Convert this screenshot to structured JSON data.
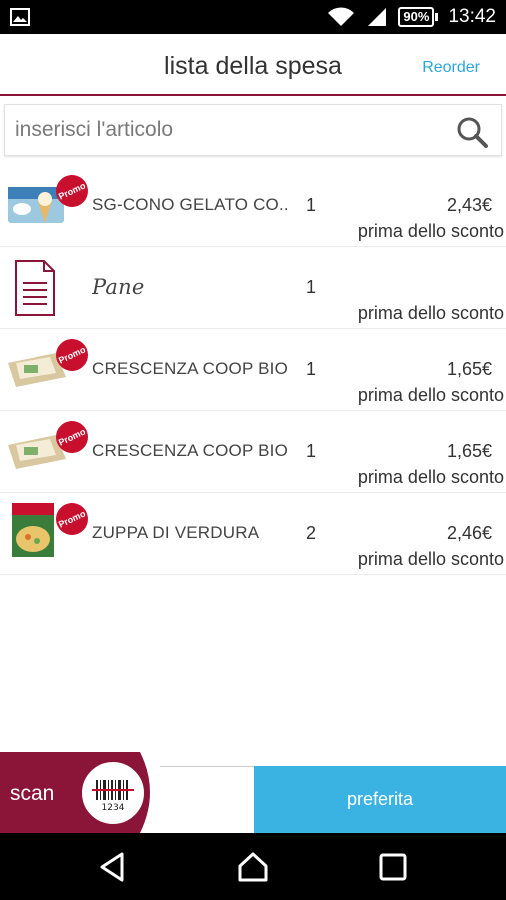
{
  "status_bar": {
    "battery": "90%",
    "time": "13:42",
    "icons": [
      "image-icon",
      "wifi-icon",
      "signal-icon",
      "battery-icon"
    ]
  },
  "header": {
    "title": "lista della spesa",
    "reorder_label": "Reorder"
  },
  "search": {
    "placeholder": "inserisci l'articolo",
    "value": ""
  },
  "items": [
    {
      "name": "SG-CONO GELATO CO..",
      "qty": "1",
      "price": "2,43€",
      "note": "prima dello sconto",
      "promo": "Promo",
      "thumb": "ice-cream-pack"
    },
    {
      "name": "Pane",
      "qty": "1",
      "price": "",
      "note": "prima dello sconto",
      "promo": "",
      "thumb": "document-icon"
    },
    {
      "name": "CRESCENZA COOP BIO",
      "qty": "1",
      "price": "1,65€",
      "note": "prima dello sconto",
      "promo": "Promo",
      "thumb": "cheese-pack"
    },
    {
      "name": "CRESCENZA COOP BIO",
      "qty": "1",
      "price": "1,65€",
      "note": "prima dello sconto",
      "promo": "Promo",
      "thumb": "cheese-pack"
    },
    {
      "name": "ZUPPA DI VERDURA",
      "qty": "2",
      "price": "2,46€",
      "note": "prima dello sconto",
      "promo": "Promo",
      "thumb": "soup-pack"
    }
  ],
  "bottom": {
    "scan_label": "scan",
    "barcode_digits": "1234",
    "preferita_label": "preferita"
  },
  "colors": {
    "brand": "#8a1538",
    "accent": "#3ab3e3",
    "promo": "#c8102e"
  }
}
